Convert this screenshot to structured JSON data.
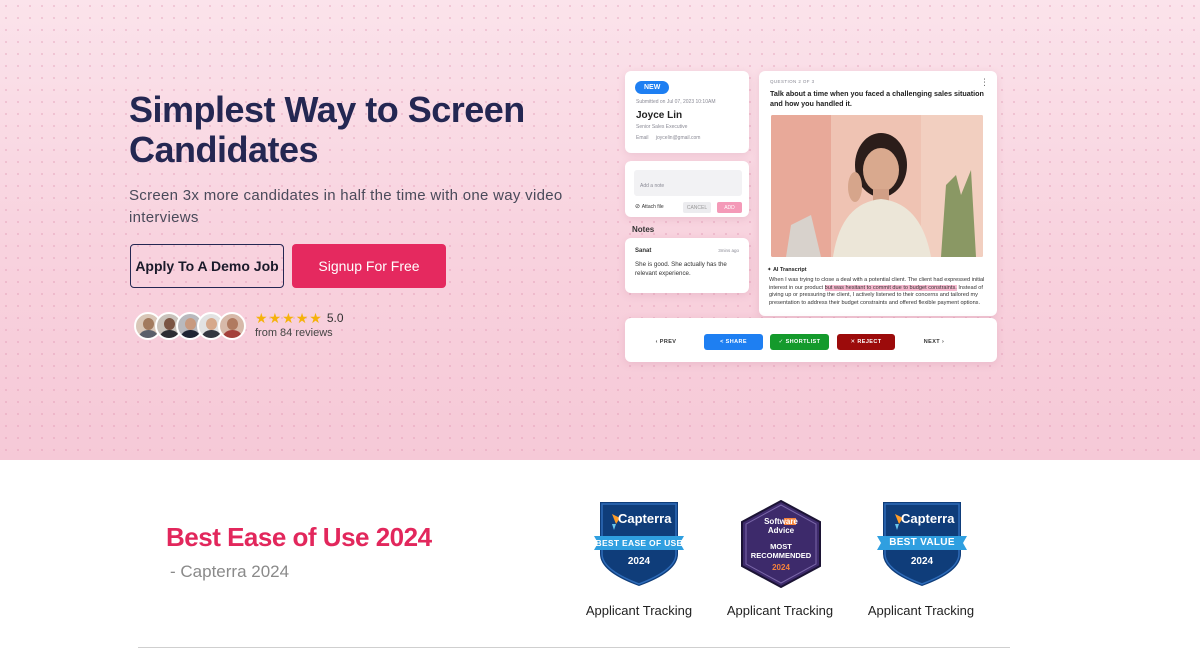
{
  "hero": {
    "title": "Simplest Way to Screen Candidates",
    "subtitle": "Screen 3x more candidates in half the time with one way video interviews",
    "demo_button": "Apply To A Demo Job",
    "signup_button": "Signup For Free",
    "rating_value": "5.0",
    "reviews_text": "from 84 reviews",
    "stars": 5
  },
  "mockup": {
    "candidate": {
      "badge": "NEW",
      "submitted": "Submitted on Jul 07, 2023 10:10AM",
      "name": "Joyce Lin",
      "role": "Senior Sales Executive",
      "email_label": "Email",
      "email": "joycelin@gmail.com"
    },
    "note_box": {
      "placeholder": "Add a note",
      "attach": "Attach file",
      "cancel": "CANCEL",
      "add": "ADD"
    },
    "notes_label": "Notes",
    "note": {
      "author": "Sanat",
      "time": "3mins ago",
      "text": "She is good. She actually has the relevant experience."
    },
    "question": {
      "counter": "QUESTION 2 OF 3",
      "text": "Talk about a time when you faced a challenging sales situation and how you handled it.",
      "transcript_label": "AI Transcript",
      "transcript_before": "When I was trying to close a deal with a potential client. The client had expressed initial interest in our product ",
      "transcript_highlight": "but was hesitant to commit due to budget constraints.",
      "transcript_after": " Instead of giving up or pressuring the client, I actively listened to their concerns and tailored my presentation to address their budget constraints and offered flexible payment options."
    },
    "nav": {
      "prev": "‹ PREV",
      "share": "< SHARE",
      "shortlist": "✓ SHORTLIST",
      "reject": "✕ REJECT",
      "next": "NEXT ›"
    }
  },
  "awards": {
    "title": "Best Ease of Use 2024",
    "source": "- Capterra 2024",
    "badges": [
      {
        "brand": "Capterra",
        "ribbon": "BEST EASE OF USE",
        "year": "2024",
        "label": "Applicant Tracking",
        "color": "#0f3d7a"
      },
      {
        "brand": "Software Advice",
        "ribbon": "MOST RECOMMENDED",
        "year": "2024",
        "label": "Applicant Tracking",
        "color": "#3d2a6b"
      },
      {
        "brand": "Capterra",
        "ribbon": "BEST VALUE",
        "year": "2024",
        "label": "Applicant Tracking",
        "color": "#0f3d7a"
      }
    ]
  },
  "colors": {
    "primary": "#e5295f",
    "navy": "#242752",
    "share": "#1e7ff2",
    "shortlist": "#149a2c",
    "reject": "#9c0b0b",
    "star": "#f5b20b"
  }
}
